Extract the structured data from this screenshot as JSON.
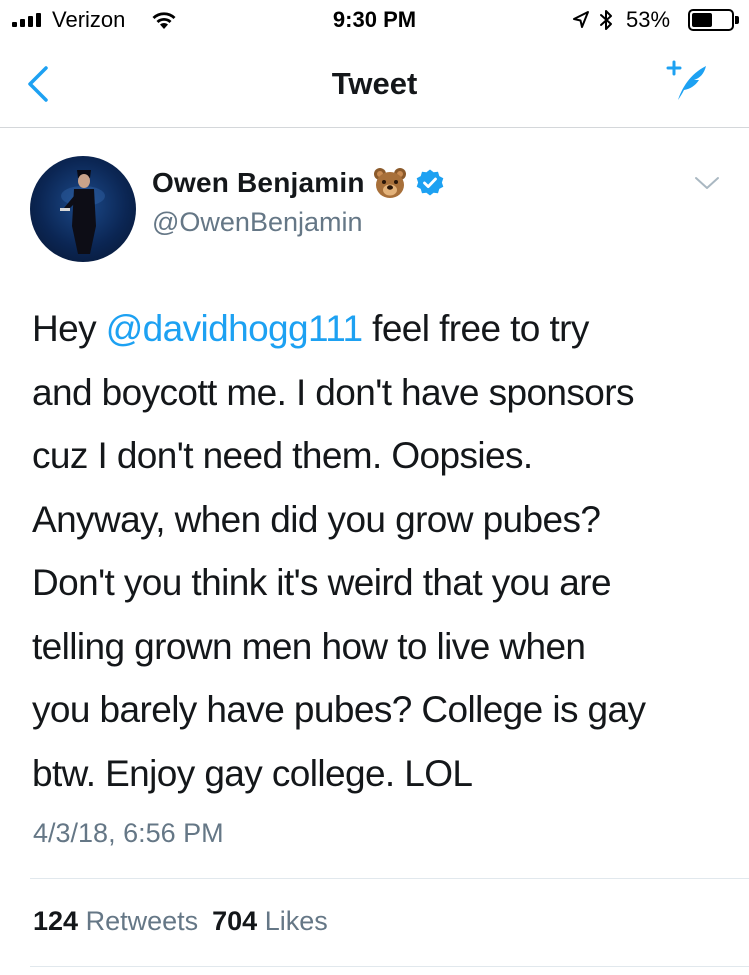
{
  "status_bar": {
    "carrier": "Verizon",
    "time": "9:30 PM",
    "battery_percent": "53%",
    "battery_level": 0.53,
    "signal_bars": 4
  },
  "nav": {
    "title": "Tweet",
    "back_icon": "chevron-left-icon",
    "compose_icon": "compose-tweet-icon"
  },
  "tweet": {
    "author": {
      "display_name": "Owen Benjamin",
      "handle": "@OwenBenjamin",
      "emoji_icon": "bear-face-icon",
      "verified_icon": "verified-badge-icon"
    },
    "text_prefix": "Hey ",
    "mention": "@davidhogg111",
    "text_rest": " feel free to try\nand boycott me. I don't have sponsors\ncuz I don't need them. Oopsies.\nAnyway, when did you grow pubes?\nDon't you think it's weird that you are\ntelling grown men how to live when\nyou barely have pubes? College is gay\nbtw. Enjoy gay college. LOL",
    "timestamp": "4/3/18, 6:56 PM",
    "retweets_count": "124",
    "retweets_label": "Retweets",
    "likes_count": "704",
    "likes_label": "Likes"
  },
  "colors": {
    "accent": "#1da1f2",
    "secondary_text": "#657786",
    "primary_text": "#14171a",
    "divider": "#e1e8ed"
  }
}
